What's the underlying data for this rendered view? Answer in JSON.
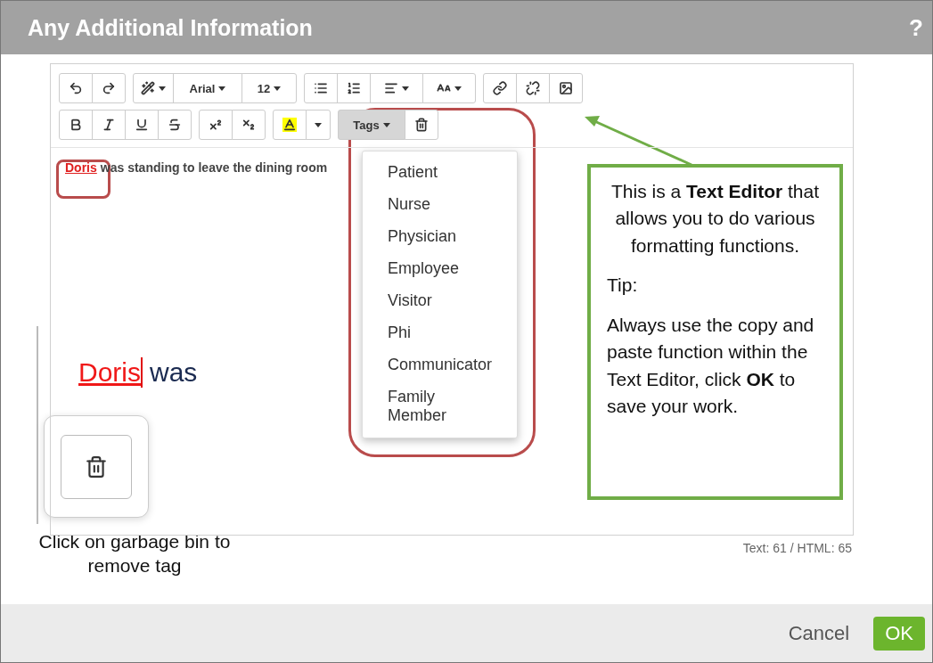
{
  "dialog": {
    "title": "Any Additional Information",
    "help": "?"
  },
  "toolbar": {
    "font": "Arial",
    "size": "12",
    "tags_button": {
      "label": "Tags",
      "expanded": true
    }
  },
  "tags_menu": [
    "Patient",
    "Nurse",
    "Physician",
    "Employee",
    "Visitor",
    "Phi",
    "Communicator",
    "Family Member"
  ],
  "editor": {
    "tag": "Doris",
    "text": "was standing to leave the dining room",
    "counter": "Text: 61 / HTML: 65"
  },
  "zoom_inset": {
    "tag": "Doris",
    "text": "was"
  },
  "annotations": {
    "trash_caption": "Click on garbage bin to remove tag",
    "callout": [
      "This is a **Text Editor** that allows you to do various formatting functions.",
      "Tip:",
      "Always use the copy and paste function within the Text Editor, click **OK** to save your work."
    ]
  },
  "footer": {
    "buttons": [
      {
        "label": "Cancel",
        "kind": "link"
      },
      {
        "label": "OK",
        "kind": "primary"
      }
    ]
  }
}
